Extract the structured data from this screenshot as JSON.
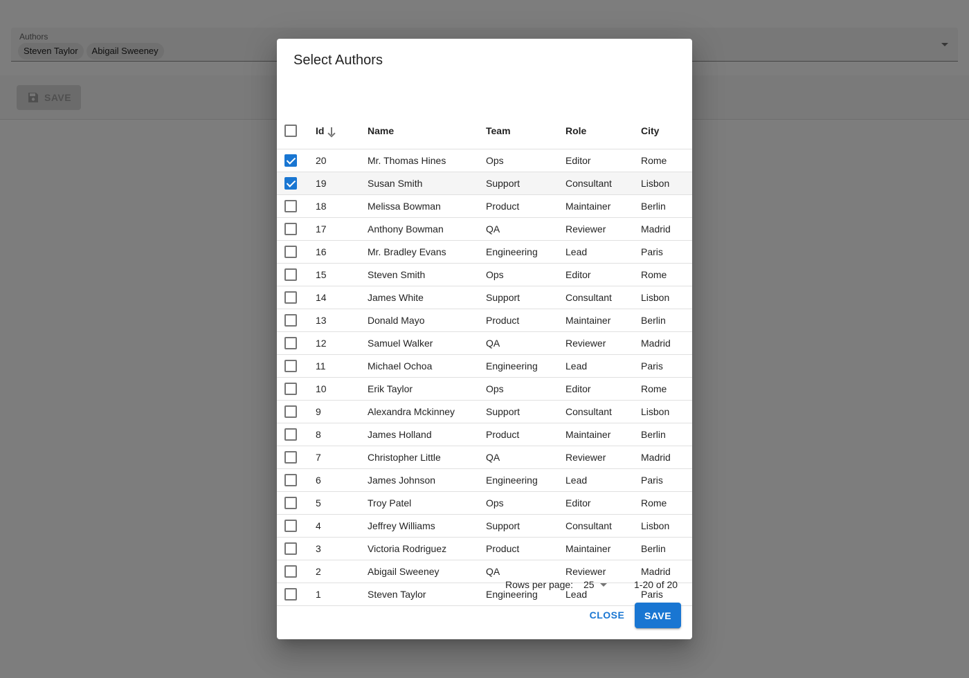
{
  "form": {
    "authors_label": "Authors",
    "selected_chips": [
      "Steven Taylor",
      "Abigail Sweeney"
    ],
    "save_label": "SAVE"
  },
  "dialog": {
    "title": "Select Authors",
    "columns": {
      "id": "Id",
      "name": "Name",
      "team": "Team",
      "role": "Role",
      "city": "City"
    },
    "sort": {
      "column": "id",
      "direction": "descending",
      "icon": "arrow-down-icon"
    },
    "rows": [
      {
        "id": "20",
        "name": "Mr. Thomas Hines",
        "team": "Ops",
        "role": "Editor",
        "city": "Rome",
        "checked": true
      },
      {
        "id": "19",
        "name": "Susan Smith",
        "team": "Support",
        "role": "Consultant",
        "city": "Lisbon",
        "checked": true
      },
      {
        "id": "18",
        "name": "Melissa Bowman",
        "team": "Product",
        "role": "Maintainer",
        "city": "Berlin",
        "checked": false
      },
      {
        "id": "17",
        "name": "Anthony Bowman",
        "team": "QA",
        "role": "Reviewer",
        "city": "Madrid",
        "checked": false
      },
      {
        "id": "16",
        "name": "Mr. Bradley Evans",
        "team": "Engineering",
        "role": "Lead",
        "city": "Paris",
        "checked": false
      },
      {
        "id": "15",
        "name": "Steven Smith",
        "team": "Ops",
        "role": "Editor",
        "city": "Rome",
        "checked": false
      },
      {
        "id": "14",
        "name": "James White",
        "team": "Support",
        "role": "Consultant",
        "city": "Lisbon",
        "checked": false
      },
      {
        "id": "13",
        "name": "Donald Mayo",
        "team": "Product",
        "role": "Maintainer",
        "city": "Berlin",
        "checked": false
      },
      {
        "id": "12",
        "name": "Samuel Walker",
        "team": "QA",
        "role": "Reviewer",
        "city": "Madrid",
        "checked": false
      },
      {
        "id": "11",
        "name": "Michael Ochoa",
        "team": "Engineering",
        "role": "Lead",
        "city": "Paris",
        "checked": false
      },
      {
        "id": "10",
        "name": "Erik Taylor",
        "team": "Ops",
        "role": "Editor",
        "city": "Rome",
        "checked": false
      },
      {
        "id": "9",
        "name": "Alexandra Mckinney",
        "team": "Support",
        "role": "Consultant",
        "city": "Lisbon",
        "checked": false
      },
      {
        "id": "8",
        "name": "James Holland",
        "team": "Product",
        "role": "Maintainer",
        "city": "Berlin",
        "checked": false
      },
      {
        "id": "7",
        "name": "Christopher Little",
        "team": "QA",
        "role": "Reviewer",
        "city": "Madrid",
        "checked": false
      },
      {
        "id": "6",
        "name": "James Johnson",
        "team": "Engineering",
        "role": "Lead",
        "city": "Paris",
        "checked": false
      },
      {
        "id": "5",
        "name": "Troy Patel",
        "team": "Ops",
        "role": "Editor",
        "city": "Rome",
        "checked": false
      },
      {
        "id": "4",
        "name": "Jeffrey Williams",
        "team": "Support",
        "role": "Consultant",
        "city": "Lisbon",
        "checked": false
      },
      {
        "id": "3",
        "name": "Victoria Rodriguez",
        "team": "Product",
        "role": "Maintainer",
        "city": "Berlin",
        "checked": false
      },
      {
        "id": "2",
        "name": "Abigail Sweeney",
        "team": "QA",
        "role": "Reviewer",
        "city": "Madrid",
        "checked": false
      },
      {
        "id": "1",
        "name": "Steven Taylor",
        "team": "Engineering",
        "role": "Lead",
        "city": "Paris",
        "checked": false
      }
    ],
    "pagination": {
      "rows_per_page_label": "Rows per page:",
      "rows_per_page_value": "25",
      "range": "1-20 of 20"
    },
    "actions": {
      "close_label": "CLOSE",
      "save_label": "SAVE"
    }
  },
  "colors": {
    "primary": "#1976d2",
    "backdrop": "rgba(0,0,0,0.5)"
  }
}
